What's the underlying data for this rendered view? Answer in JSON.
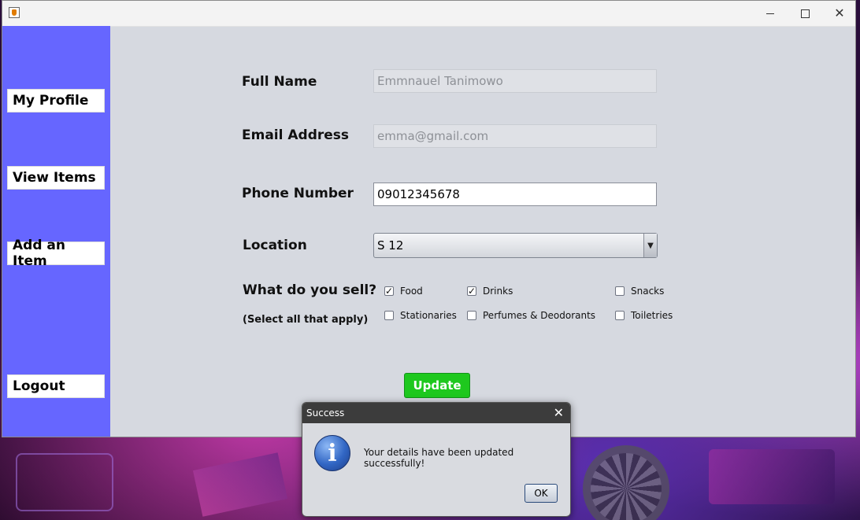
{
  "window": {
    "title": ""
  },
  "sidebar": {
    "items": [
      {
        "label": "My Profile"
      },
      {
        "label": "View Items"
      },
      {
        "label": "Add an Item"
      },
      {
        "label": "Logout"
      }
    ]
  },
  "form": {
    "full_name": {
      "label": "Full Name",
      "value": "Emmnauel Tanimowo"
    },
    "email": {
      "label": "Email Address",
      "value": "emma@gmail.com"
    },
    "phone": {
      "label": "Phone Number",
      "value": "09012345678"
    },
    "location": {
      "label": "Location",
      "value": "S 12"
    },
    "sell": {
      "label": "What do you sell?",
      "hint": "(Select all that apply)",
      "options": [
        {
          "label": "Food",
          "checked": true
        },
        {
          "label": "Drinks",
          "checked": true
        },
        {
          "label": "Snacks",
          "checked": false
        },
        {
          "label": "Stationaries",
          "checked": false
        },
        {
          "label": "Perfumes & Deodorants",
          "checked": false
        },
        {
          "label": "Toiletries",
          "checked": false
        }
      ]
    },
    "update_label": "Update"
  },
  "dialog": {
    "title": "Success",
    "message": "Your details have been updated successfully!",
    "ok_label": "OK",
    "icon": "info-icon"
  },
  "colors": {
    "sidebar": "#6666ff",
    "update_button": "#1ec81e"
  }
}
